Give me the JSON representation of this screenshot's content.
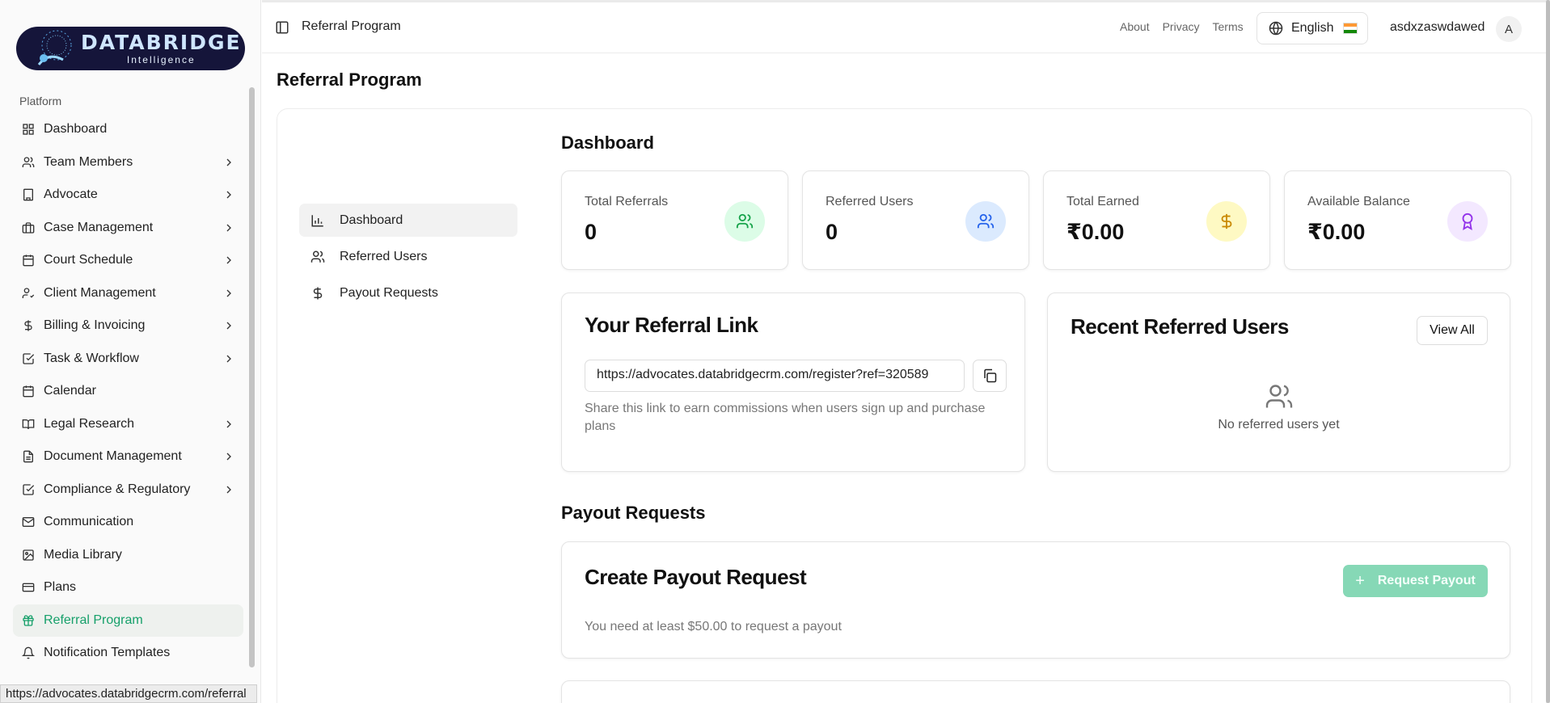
{
  "logo": {
    "main": "DATABRIDGE",
    "sub": "Intelligence"
  },
  "sidebar": {
    "group_label": "Platform",
    "items": [
      {
        "label": "Dashboard",
        "icon": "grid-icon",
        "chevron": false
      },
      {
        "label": "Team Members",
        "icon": "users-icon",
        "chevron": true
      },
      {
        "label": "Advocate",
        "icon": "building-icon",
        "chevron": true
      },
      {
        "label": "Case Management",
        "icon": "briefcase-icon",
        "chevron": true
      },
      {
        "label": "Court Schedule",
        "icon": "calendar-icon",
        "chevron": true
      },
      {
        "label": "Client Management",
        "icon": "user-cog-icon",
        "chevron": true
      },
      {
        "label": "Billing & Invoicing",
        "icon": "dollar-icon",
        "chevron": true
      },
      {
        "label": "Task & Workflow",
        "icon": "check-square-icon",
        "chevron": true
      },
      {
        "label": "Calendar",
        "icon": "calendar-days-icon",
        "chevron": false
      },
      {
        "label": "Legal Research",
        "icon": "book-icon",
        "chevron": true
      },
      {
        "label": "Document Management",
        "icon": "file-icon",
        "chevron": true
      },
      {
        "label": "Compliance & Regulatory",
        "icon": "check-square-icon",
        "chevron": true
      },
      {
        "label": "Communication",
        "icon": "mail-icon",
        "chevron": false
      },
      {
        "label": "Media Library",
        "icon": "image-icon",
        "chevron": false
      },
      {
        "label": "Plans",
        "icon": "credit-card-icon",
        "chevron": false
      },
      {
        "label": "Referral Program",
        "icon": "gift-icon",
        "chevron": false,
        "active": true
      },
      {
        "label": "Notification Templates",
        "icon": "bell-icon",
        "chevron": false
      }
    ]
  },
  "status_url": "https://advocates.databridgecrm.com/referral",
  "topbar": {
    "breadcrumb": "Referral Program",
    "links": [
      "About",
      "Privacy",
      "Terms"
    ],
    "language": "English",
    "username": "asdxzaswdawed",
    "avatar_initial": "A"
  },
  "page": {
    "title": "Referral Program"
  },
  "subnav": [
    {
      "label": "Dashboard",
      "active": true
    },
    {
      "label": "Referred Users"
    },
    {
      "label": "Payout Requests"
    }
  ],
  "dashboard": {
    "title": "Dashboard",
    "stats": [
      {
        "label": "Total Referrals",
        "value": "0",
        "color": "#16a34a",
        "bg": "#dcfce7"
      },
      {
        "label": "Referred Users",
        "value": "0",
        "color": "#2563eb",
        "bg": "#dbeafe"
      },
      {
        "label": "Total Earned",
        "value": "₹0.00",
        "color": "#ca8a04",
        "bg": "#fef9c3"
      },
      {
        "label": "Available Balance",
        "value": "₹0.00",
        "color": "#9333ea",
        "bg": "#f3e8ff"
      }
    ]
  },
  "referral_link": {
    "title": "Your Referral Link",
    "url": "https://advocates.databridgecrm.com/register?ref=320589",
    "help": "Share this link to earn commissions when users sign up and purchase plans"
  },
  "recent_users": {
    "title": "Recent Referred Users",
    "view_all": "View All",
    "empty": "No referred users yet"
  },
  "payouts": {
    "section_title": "Payout Requests",
    "card_title": "Create Payout Request",
    "button": "Request Payout",
    "note": "You need at least $50.00 to request a payout"
  }
}
